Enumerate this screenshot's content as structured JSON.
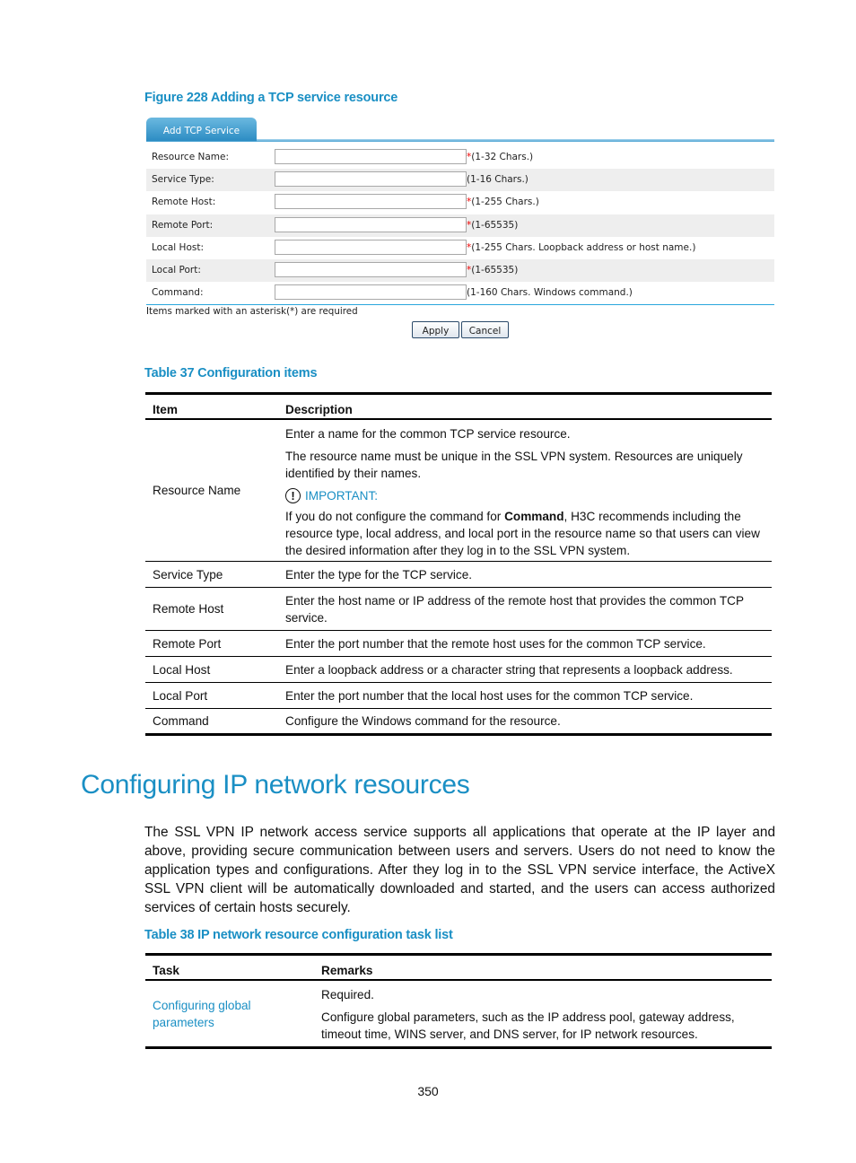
{
  "figure": {
    "caption": "Figure 228 Adding a TCP service resource",
    "tab_label": "Add TCP Service",
    "fields": [
      {
        "label": "Resource Name:",
        "value": "",
        "required": true,
        "hint": "(1-32 Chars.)"
      },
      {
        "label": "Service Type:",
        "value": "",
        "required": false,
        "hint": "(1-16 Chars.)"
      },
      {
        "label": "Remote Host:",
        "value": "",
        "required": true,
        "hint": "(1-255 Chars.)"
      },
      {
        "label": "Remote Port:",
        "value": "",
        "required": true,
        "hint": "(1-65535)"
      },
      {
        "label": "Local Host:",
        "value": "",
        "required": true,
        "hint": "(1-255 Chars. Loopback address or host name.)"
      },
      {
        "label": "Local Port:",
        "value": "",
        "required": true,
        "hint": "(1-65535)"
      },
      {
        "label": "Command:",
        "value": "",
        "required": false,
        "hint": "(1-160 Chars. Windows command.)"
      }
    ],
    "required_asterisk": "*",
    "required_note": "Items marked with an asterisk(*) are required",
    "apply_label": "Apply",
    "cancel_label": "Cancel"
  },
  "table37": {
    "caption": "Table 37 Configuration items",
    "headers": [
      "Item",
      "Description"
    ],
    "resource_name": {
      "item": "Resource Name",
      "p1": "Enter a name for the common TCP service resource.",
      "p2": "The resource name must be unique in the SSL VPN system. Resources are uniquely identified by their names.",
      "important_label": "IMPORTANT:",
      "important_icon": "!",
      "p3_before": "If you do not configure the command for ",
      "p3_bold": "Command",
      "p3_after": ", H3C recommends including the resource type, local address, and local port in the resource name so that users can view the desired information after they log in to the SSL VPN system."
    },
    "rows": [
      {
        "item": "Service Type",
        "description": "Enter the type for the TCP service."
      },
      {
        "item": "Remote Host",
        "description": "Enter the host name or IP address of the remote host that provides the common TCP service."
      },
      {
        "item": "Remote Port",
        "description": "Enter the port number that the remote host uses for the common TCP service."
      },
      {
        "item": "Local Host",
        "description": "Enter a loopback address or a character string that represents a loopback address."
      },
      {
        "item": "Local Port",
        "description": "Enter the port number that the local host uses for the common TCP service."
      },
      {
        "item": "Command",
        "description": "Configure the Windows command for the resource."
      }
    ]
  },
  "section": {
    "title": "Configuring IP network resources",
    "intro": "The SSL VPN IP network access service supports all applications that operate at the IP layer and above, providing secure communication between users and servers. Users do not need to know the application types and configurations. After they log in to the SSL VPN service interface, the ActiveX SSL VPN client will be automatically downloaded and started, and the users can access authorized services of certain hosts securely."
  },
  "table38": {
    "caption": "Table 38 IP network resource configuration task list",
    "headers": [
      "Task",
      "Remarks"
    ],
    "rows": [
      {
        "task": "Configuring global parameters",
        "remark1": "Required.",
        "remark2": "Configure global parameters, such as the IP address pool, gateway address, timeout time, WINS server, and DNS server, for IP network resources."
      }
    ]
  },
  "page_number": "350",
  "colors": {
    "accent": "#1a8fc4",
    "required": "#ee0000",
    "tab": "#2c8cc3"
  }
}
